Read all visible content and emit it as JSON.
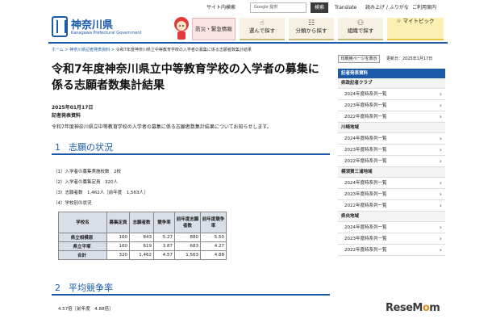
{
  "header": {
    "logo_ja": "神奈川県",
    "logo_en": "Kanagawa Prefectural Government",
    "util_site_search": "サイト内検索",
    "search_placeholder": "Google 提供",
    "search_button": "検索",
    "util_translate": "Translate",
    "util_furigana": "読み上げ / ふりがな",
    "util_howto": "ご利用案内",
    "nav": [
      {
        "label": "防災・緊急情報"
      },
      {
        "label": "選んで探す"
      },
      {
        "label": "分類から探す"
      },
      {
        "label": "組織で探す"
      },
      {
        "label": "マイトピック"
      }
    ]
  },
  "breadcrumb": {
    "home": "ホーム",
    "sep": ">",
    "parent": "神奈川県記者発表資料",
    "current": "令和7年度神奈川県立中等教育学校の入学者の募集に係る志願者数集計結果"
  },
  "article": {
    "title": "令和7年度神奈川県立中等教育学校の入学者の募集に係る志願者数集計結果",
    "date": "2025年01月17日",
    "category": "記者発表資料",
    "lead": "令和7年度神奈川県立中等教育学校の入学者の募集に係る志願者数集計結果についてお知らせします。",
    "section1_num": "1",
    "section1_title": "志願の状況",
    "items": [
      "（1）入学者の募集実施校数　2校",
      "（2）入学者の募集定員　320人",
      "（3）志願者数　1,462人［前年度　1,563人］",
      "（4）学校別の状況"
    ],
    "table": {
      "headers": [
        "学校名",
        "募集定員",
        "志願者数",
        "競争率",
        "前年度志願者数",
        "前年度競争率"
      ],
      "rows": [
        [
          "県立相模原",
          "160",
          "843",
          "5.27",
          "880",
          "5.50"
        ],
        [
          "県立平塚",
          "160",
          "619",
          "3.87",
          "683",
          "4.27"
        ],
        [
          "合計",
          "320",
          "1,462",
          "4.57",
          "1,563",
          "4.88"
        ]
      ]
    },
    "section2_num": "2",
    "section2_title": "平均競争率",
    "avg_text": "4.57倍［前年度　4.88倍］"
  },
  "sidebar": {
    "print_button": "印刷用ページを表示",
    "updated": "更新日：2025年1月17日",
    "head": "記者発表資料",
    "groups": [
      {
        "title": "県政記者クラブ",
        "links": [
          "2024年度時系列一覧",
          "2023年度時系列一覧",
          "2022年度時系列一覧"
        ]
      },
      {
        "title": "川崎地域",
        "links": [
          "2024年度時系列一覧",
          "2023年度時系列一覧",
          "2022年度時系列一覧"
        ]
      },
      {
        "title": "横須賀三浦地域",
        "links": [
          "2024年度時系列一覧",
          "2023年度時系列一覧",
          "2022年度時系列一覧"
        ]
      },
      {
        "title": "県央地域",
        "links": [
          "2024年度時系列一覧",
          "2023年度時系列一覧",
          "2022年度時系列一覧"
        ]
      }
    ]
  },
  "watermark": {
    "pre": "ReseM",
    "o": "o",
    "post": "m"
  }
}
